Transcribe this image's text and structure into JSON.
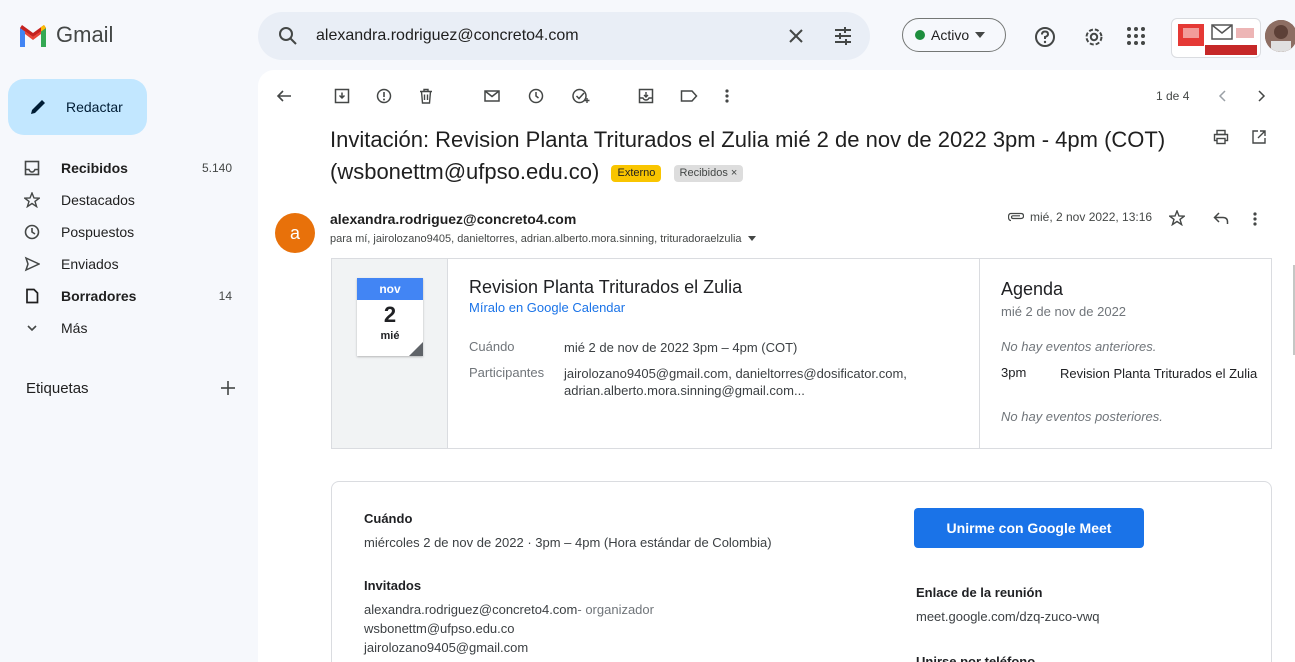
{
  "app": {
    "name": "Gmail"
  },
  "search": {
    "query": "alexandra.rodriguez@concreto4.com"
  },
  "status": {
    "label": "Activo",
    "color": "#1e8e3e"
  },
  "org_logo_text": "www.ufpso.edu.co",
  "sidebar": {
    "compose_label": "Redactar",
    "items": [
      {
        "label": "Recibidos",
        "count": "5.140",
        "icon": "inbox-icon",
        "bold": true
      },
      {
        "label": "Destacados",
        "count": "",
        "icon": "star-icon",
        "bold": false
      },
      {
        "label": "Pospuestos",
        "count": "",
        "icon": "clock-icon",
        "bold": false
      },
      {
        "label": "Enviados",
        "count": "",
        "icon": "send-icon",
        "bold": false
      },
      {
        "label": "Borradores",
        "count": "14",
        "icon": "draft-icon",
        "bold": true
      },
      {
        "label": "Más",
        "count": "",
        "icon": "chevron-down-icon",
        "bold": false
      }
    ],
    "labels_heading": "Etiquetas"
  },
  "toolbar": {
    "pager": "1 de 4"
  },
  "email": {
    "subject": "Invitación: Revision Planta Triturados el Zulia mié 2 de nov de 2022 3pm - 4pm (COT) (wsbonettm@ufpso.edu.co)",
    "chips": {
      "external": "Externo",
      "inbox": "Recibidos ×"
    },
    "sender_initial": "a",
    "sender": "alexandra.rodriguez@concreto4.com",
    "recipients": "para mí, jairolozano9405, danieltorres, adrian.alberto.mora.sinning, trituradoraelzulia",
    "date": "mié, 2 nov 2022, 13:16"
  },
  "invite": {
    "cal_month": "nov",
    "cal_day": "2",
    "cal_weekday": "mié",
    "title": "Revision Planta Triturados el Zulia",
    "calendar_link": "Míralo en Google Calendar",
    "when_label": "Cuándo",
    "when_value": "mié 2 de nov de 2022 3pm – 4pm (COT)",
    "participants_label": "Participantes",
    "participants_value": "jairolozano9405@gmail.com, danieltorres@dosificator.com, adrian.alberto.mora.sinning@gmail.com..."
  },
  "agenda": {
    "title": "Agenda",
    "date": "mié 2 de nov de 2022",
    "no_previous": "No hay eventos anteriores.",
    "event_time": "3pm",
    "event_name": "Revision Planta Triturados el Zulia",
    "no_next": "No hay eventos posteriores."
  },
  "details": {
    "when_heading": "Cuándo",
    "when_text": "miércoles 2 de nov de 2022 · 3pm – 4pm (Hora estándar de Colombia)",
    "guests_heading": "Invitados",
    "guest1": "alexandra.rodriguez@concreto4.com",
    "guest1_role": "- organizador",
    "guest2": "wsbonettm@ufpso.edu.co",
    "guest3": "jairolozano9405@gmail.com",
    "meet_button": "Unirme con Google Meet",
    "meeting_link_heading": "Enlace de la reunión",
    "meeting_link": "meet.google.com/dzq-zuco-vwq",
    "phone_heading": "Unirse por teléfono"
  }
}
